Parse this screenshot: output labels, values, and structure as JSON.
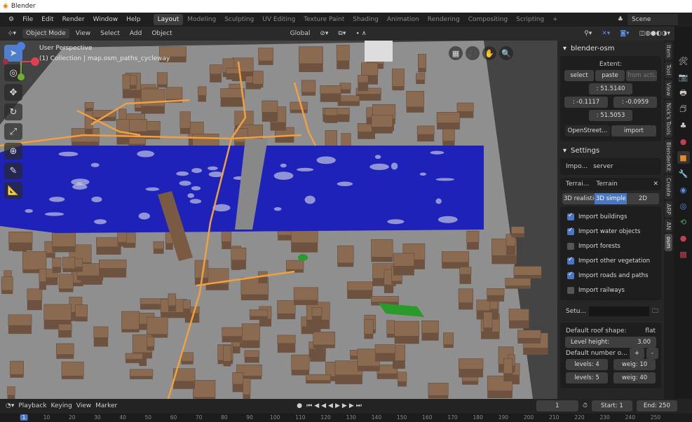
{
  "window": {
    "title": "Blender"
  },
  "menu": {
    "items": [
      "File",
      "Edit",
      "Render",
      "Window",
      "Help"
    ],
    "workspaces": [
      "Layout",
      "Modeling",
      "Sculpting",
      "UV Editing",
      "Texture Paint",
      "Shading",
      "Animation",
      "Rendering",
      "Compositing",
      "Scripting"
    ],
    "active_workspace": "Layout",
    "add": "+",
    "scene": "Scene"
  },
  "header": {
    "mode": "Object Mode",
    "items": [
      "View",
      "Select",
      "Add",
      "Object"
    ],
    "orientation": "Global"
  },
  "viewport": {
    "perspective": "User Perspective",
    "collection": "(1) Collection | map.osm_paths_cycleway",
    "colors": {
      "ground": "#8f8f8f",
      "water": "#1f22b8",
      "building": "#8a6a50",
      "road": "#f0a040"
    }
  },
  "npanel": {
    "addon_title": "blender-osm",
    "extent_label": "Extent:",
    "select": "select",
    "paste": "paste",
    "from_active": "from acti...",
    "north": ": 51.5140",
    "west": ": -0.1117",
    "east": ": -0.0959",
    "south": ": 51.5053",
    "source": "OpenStreet...",
    "import": "import",
    "settings_title": "Settings",
    "import_from_label": "Impo...",
    "import_from_value": "server",
    "terrain_label": "Terrai...",
    "terrain_value": "Terrain",
    "modes": [
      "3D realistic",
      "3D simple",
      "2D"
    ],
    "active_mode": "3D simple",
    "checks": [
      {
        "label": "Import buildings",
        "checked": true
      },
      {
        "label": "Import water objects",
        "checked": true
      },
      {
        "label": "Import forests",
        "checked": false
      },
      {
        "label": "Import other vegetation",
        "checked": true
      },
      {
        "label": "Import roads and paths",
        "checked": true
      },
      {
        "label": "Import railways",
        "checked": false
      }
    ],
    "setup_label": "Setu...",
    "roof_label": "Default roof shape:",
    "roof_value": "flat",
    "level_height_label": "Level height:",
    "level_height_value": "3.00",
    "default_number_label": "Default number o...",
    "plus": "+",
    "minus": "-",
    "levels": [
      {
        "levels": "levels:  4",
        "weight": "weig:  10"
      },
      {
        "levels": "levels:  5",
        "weight": "weig:  40"
      }
    ]
  },
  "tabs": [
    "Item",
    "Tool",
    "View",
    "Nick's Tools",
    "BlenderKit",
    "Create",
    "ARP",
    "AN",
    "osm"
  ],
  "active_tab": "osm",
  "timeline": {
    "items": [
      "Playback",
      "Keying",
      "View",
      "Marker"
    ],
    "current_frame": "1",
    "start_label": "Start:",
    "start": "1",
    "end_label": "End:",
    "end": "250",
    "ticks": [
      "1",
      "10",
      "20",
      "30",
      "40",
      "50",
      "60",
      "70",
      "80",
      "90",
      "100",
      "110",
      "120",
      "130",
      "140",
      "150",
      "160",
      "170",
      "180",
      "190",
      "200",
      "210",
      "220",
      "230",
      "240",
      "250"
    ]
  }
}
